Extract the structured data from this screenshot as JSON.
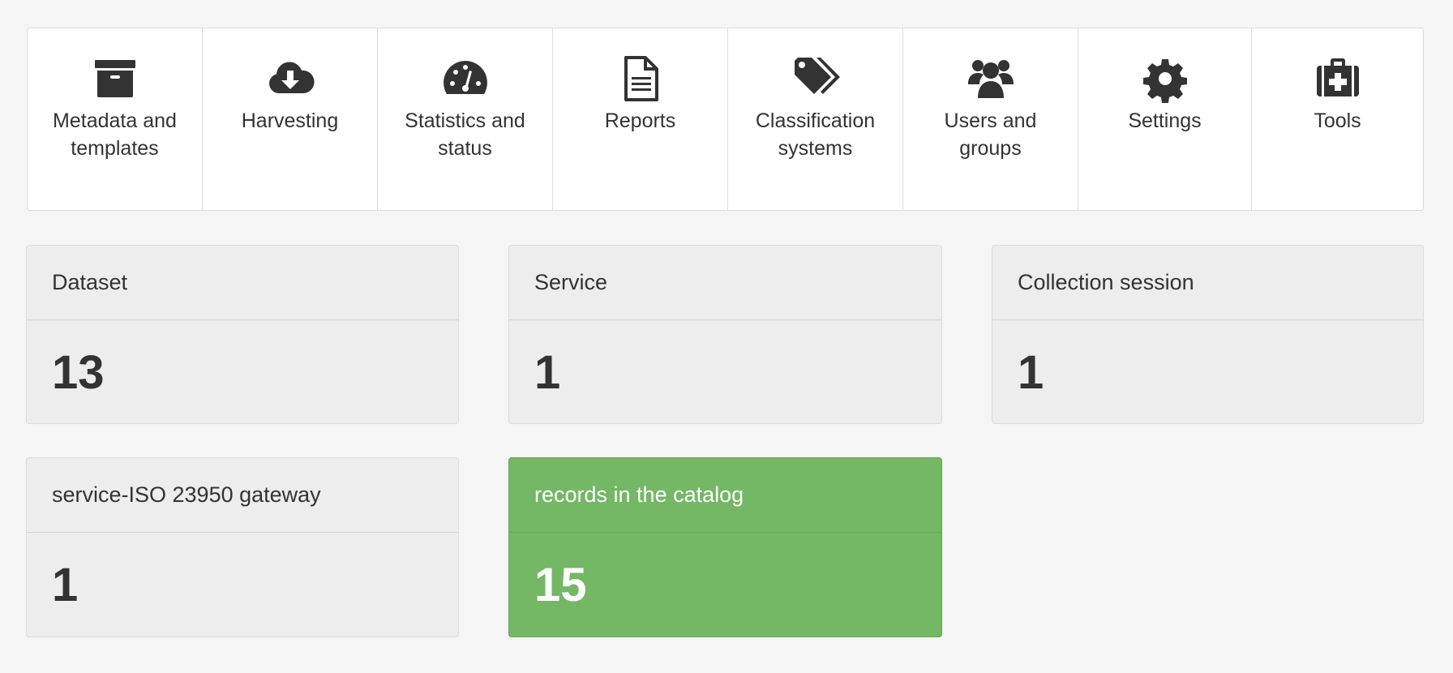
{
  "nav": [
    {
      "id": "metadata",
      "label": "Metadata and templates",
      "icon": "archive-icon"
    },
    {
      "id": "harvesting",
      "label": "Harvesting",
      "icon": "cloud-download-icon"
    },
    {
      "id": "statistics",
      "label": "Statistics and status",
      "icon": "dashboard-icon"
    },
    {
      "id": "reports",
      "label": "Reports",
      "icon": "file-text-icon"
    },
    {
      "id": "classification",
      "label": "Classification systems",
      "icon": "tags-icon"
    },
    {
      "id": "users",
      "label": "Users and groups",
      "icon": "users-icon"
    },
    {
      "id": "settings",
      "label": "Settings",
      "icon": "gear-icon"
    },
    {
      "id": "tools",
      "label": "Tools",
      "icon": "medkit-icon"
    }
  ],
  "stats": [
    {
      "label": "Dataset",
      "value": "13"
    },
    {
      "label": "Service",
      "value": "1"
    },
    {
      "label": "Collection session",
      "value": "1"
    },
    {
      "label": "service-ISO 23950 gateway",
      "value": "1"
    },
    {
      "label": "records in the catalog",
      "value": "15",
      "color": "#74b765"
    }
  ]
}
